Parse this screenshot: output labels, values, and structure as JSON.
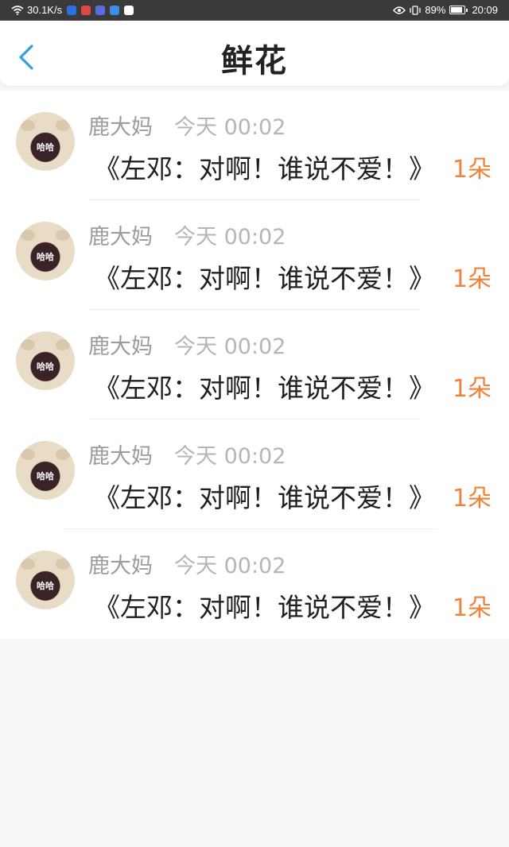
{
  "status_bar": {
    "network_speed": "30.1K/s",
    "battery": "89%",
    "time": "20:09"
  },
  "header": {
    "title": "鲜花"
  },
  "items": [
    {
      "user": "鹿大妈",
      "time": "今天 00:02",
      "title": "《左邓：对啊！谁说不爱！》",
      "count": "1朵",
      "avatar_text": "哈哈"
    },
    {
      "user": "鹿大妈",
      "time": "今天 00:02",
      "title": "《左邓：对啊！谁说不爱！》",
      "count": "1朵",
      "avatar_text": "哈哈"
    },
    {
      "user": "鹿大妈",
      "time": "今天 00:02",
      "title": "《左邓：对啊！谁说不爱！》",
      "count": "1朵",
      "avatar_text": "哈哈"
    },
    {
      "user": "鹿大妈",
      "time": "今天 00:02",
      "title": "《左邓：对啊！谁说不爱！》",
      "count": "1朵",
      "avatar_text": "哈哈"
    },
    {
      "user": "鹿大妈",
      "time": "今天 00:02",
      "title": "《左邓：对啊！谁说不爱！》",
      "count": "1朵",
      "avatar_text": "哈哈"
    }
  ],
  "colors": {
    "accent": "#2ea0ec",
    "count": "#f0823a"
  }
}
